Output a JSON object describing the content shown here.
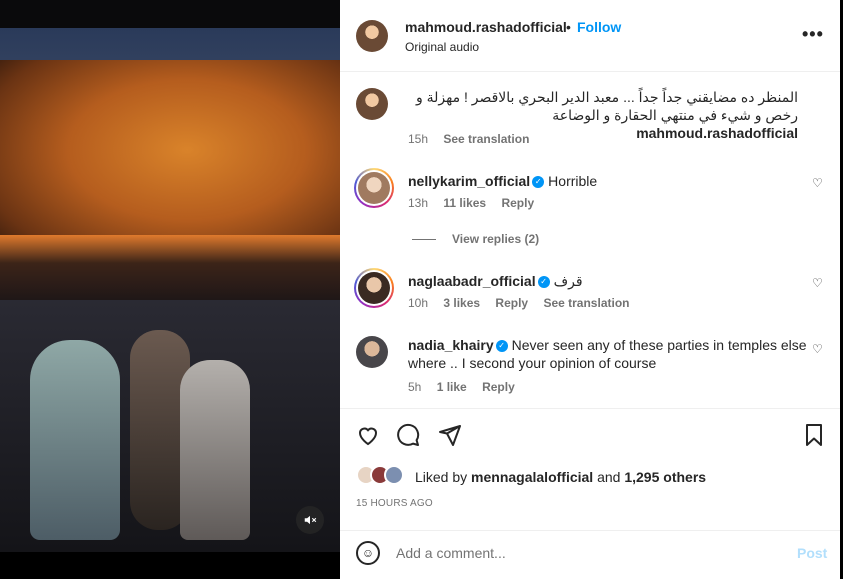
{
  "post": {
    "author": "mahmoud.rashadofficial",
    "follow_label": "Follow",
    "audio_label": "Original audio",
    "more_icon": "more-horizontal-icon"
  },
  "caption": {
    "username": "mahmoud.rashadofficial",
    "text": "المنظر ده مضايقني جداً جداً ... معبد الدير البحري بالاقصر ! مهزلة و رخص و شيء في منتهي الحقارة و الوضاعة",
    "time": "15h",
    "see_translation": "See translation"
  },
  "comments": [
    {
      "username": "nellykarim_official",
      "verified": true,
      "text": "Horrible",
      "time": "13h",
      "likes": "11 likes",
      "reply": "Reply",
      "view_replies": "View replies (2)"
    },
    {
      "username": "naglaabadr_official",
      "verified": true,
      "text": "قرف",
      "time": "10h",
      "likes": "3 likes",
      "reply": "Reply",
      "see_translation": "See translation"
    },
    {
      "username": "nadia_khairy",
      "verified": true,
      "text": "Never seen any of these parties in temples else where .. I second your opinion of course",
      "time": "5h",
      "likes": "1 like",
      "reply": "Reply"
    }
  ],
  "likes": {
    "prefix": "Liked by",
    "user": "mennagalalofficial",
    "and": "and",
    "others": "1,295 others"
  },
  "timestamp": "15 HOURS AGO",
  "add_comment": {
    "placeholder": "Add a comment...",
    "post_label": "Post"
  },
  "colors": {
    "accent": "#0095f6",
    "post_disabled": "#b2dffc",
    "muted_text": "#737373"
  }
}
